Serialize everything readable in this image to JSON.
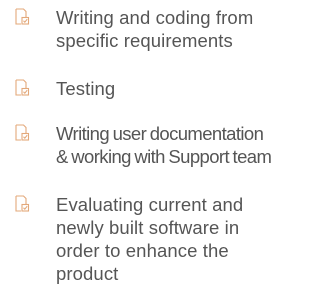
{
  "list": {
    "icon": "document-icon",
    "accent_color": "#e3a87a",
    "text_color": "#555555",
    "items": [
      {
        "lines": [
          "Writing and coding from",
          "specific requirements"
        ]
      },
      {
        "lines": [
          "Testing"
        ]
      },
      {
        "lines": [
          "Writing user documentation",
          "& working with Support team"
        ]
      },
      {
        "lines": [
          "Evaluating current and",
          "newly built software in",
          "order to enhance the",
          "product"
        ]
      }
    ]
  }
}
